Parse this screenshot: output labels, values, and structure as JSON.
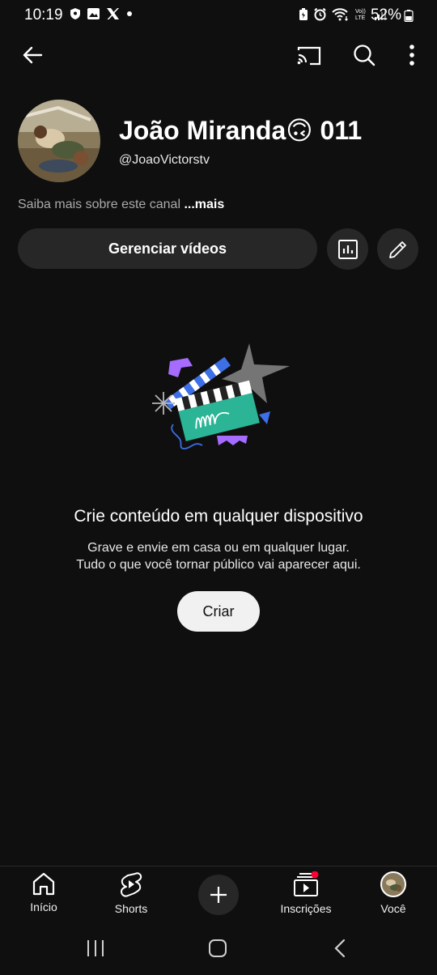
{
  "status_bar": {
    "time": "10:19",
    "battery": "52%",
    "left_icons": [
      "shield-icon",
      "image-icon",
      "x-logo-icon",
      "dot-icon"
    ],
    "right_icons": [
      "battery-saver-icon",
      "alarm-icon",
      "wifi-icon",
      "volte-icon",
      "signal-icon"
    ]
  },
  "top_bar": {
    "icons": [
      "back-arrow-icon",
      "cast-icon",
      "search-icon",
      "more-vert-icon"
    ]
  },
  "channel": {
    "name": "João Miranda🙃 011",
    "handle": "@JoaoVictorstv",
    "about": "Saiba mais sobre este canal",
    "more": "...mais"
  },
  "actions": {
    "manage_videos": "Gerenciar vídeos",
    "icons": [
      "analytics-icon",
      "edit-pencil-icon"
    ]
  },
  "empty_state": {
    "title": "Crie conteúdo em qualquer dispositivo",
    "line1": "Grave e envie em casa ou em qualquer lugar.",
    "line2": "Tudo o que você tornar público vai aparecer aqui.",
    "create_button": "Criar"
  },
  "bottom_nav": {
    "items": [
      {
        "label": "Início",
        "icon": "home-icon"
      },
      {
        "label": "Shorts",
        "icon": "shorts-icon"
      },
      {
        "label": "",
        "icon": "plus-icon"
      },
      {
        "label": "Inscrições",
        "icon": "subscriptions-icon"
      },
      {
        "label": "Você",
        "icon": "avatar"
      }
    ]
  },
  "colors": {
    "background": "#0f0f0f",
    "surface": "#272727",
    "notification_dot": "#ff0033",
    "accent_green": "#2bb596",
    "accent_blue": "#3d6fe6",
    "accent_purple": "#a66bff"
  }
}
